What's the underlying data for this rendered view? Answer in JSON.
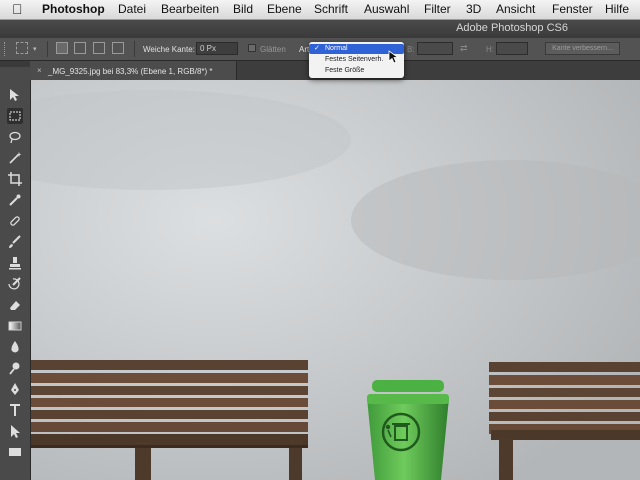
{
  "menubar": {
    "app": "Photoshop",
    "items": [
      "Datei",
      "Bearbeiten",
      "Bild",
      "Ebene",
      "Schrift",
      "Auswahl",
      "Filter",
      "3D",
      "Ansicht",
      "Fenster",
      "Hilfe"
    ]
  },
  "window": {
    "title": "Adobe Photoshop CS6"
  },
  "options": {
    "feather_label": "Weiche Kante:",
    "feather_value": "0 Px",
    "antialias_label": "Glätten",
    "style_label": "Art:",
    "width_short": "B:",
    "height_short": "H:",
    "refine_edge": "Kante verbessern..."
  },
  "style_dropdown": {
    "options": [
      "Normal",
      "Festes Seitenverh.",
      "Feste Größe"
    ],
    "selected": "Normal"
  },
  "document": {
    "tab_label": "_MG_9325.jpg bei 83,3% (Ebene 1, RGB/8*) *",
    "close": "×"
  },
  "icons": {
    "apple": "apple-icon",
    "move": "move-tool-icon",
    "marquee": "rect-marquee-icon",
    "lasso": "lasso-icon",
    "magic": "magic-wand-icon",
    "crop": "crop-icon",
    "eyedropper": "eyedropper-icon",
    "heal": "healing-brush-icon",
    "brush": "brush-icon",
    "stamp": "clone-stamp-icon",
    "history": "history-brush-icon",
    "eraser": "eraser-icon",
    "gradient": "gradient-icon",
    "blur": "blur-icon",
    "dodge": "dodge-icon",
    "pen": "pen-icon",
    "type": "type-tool-icon",
    "path": "path-select-icon",
    "shape": "rectangle-shape-icon"
  }
}
